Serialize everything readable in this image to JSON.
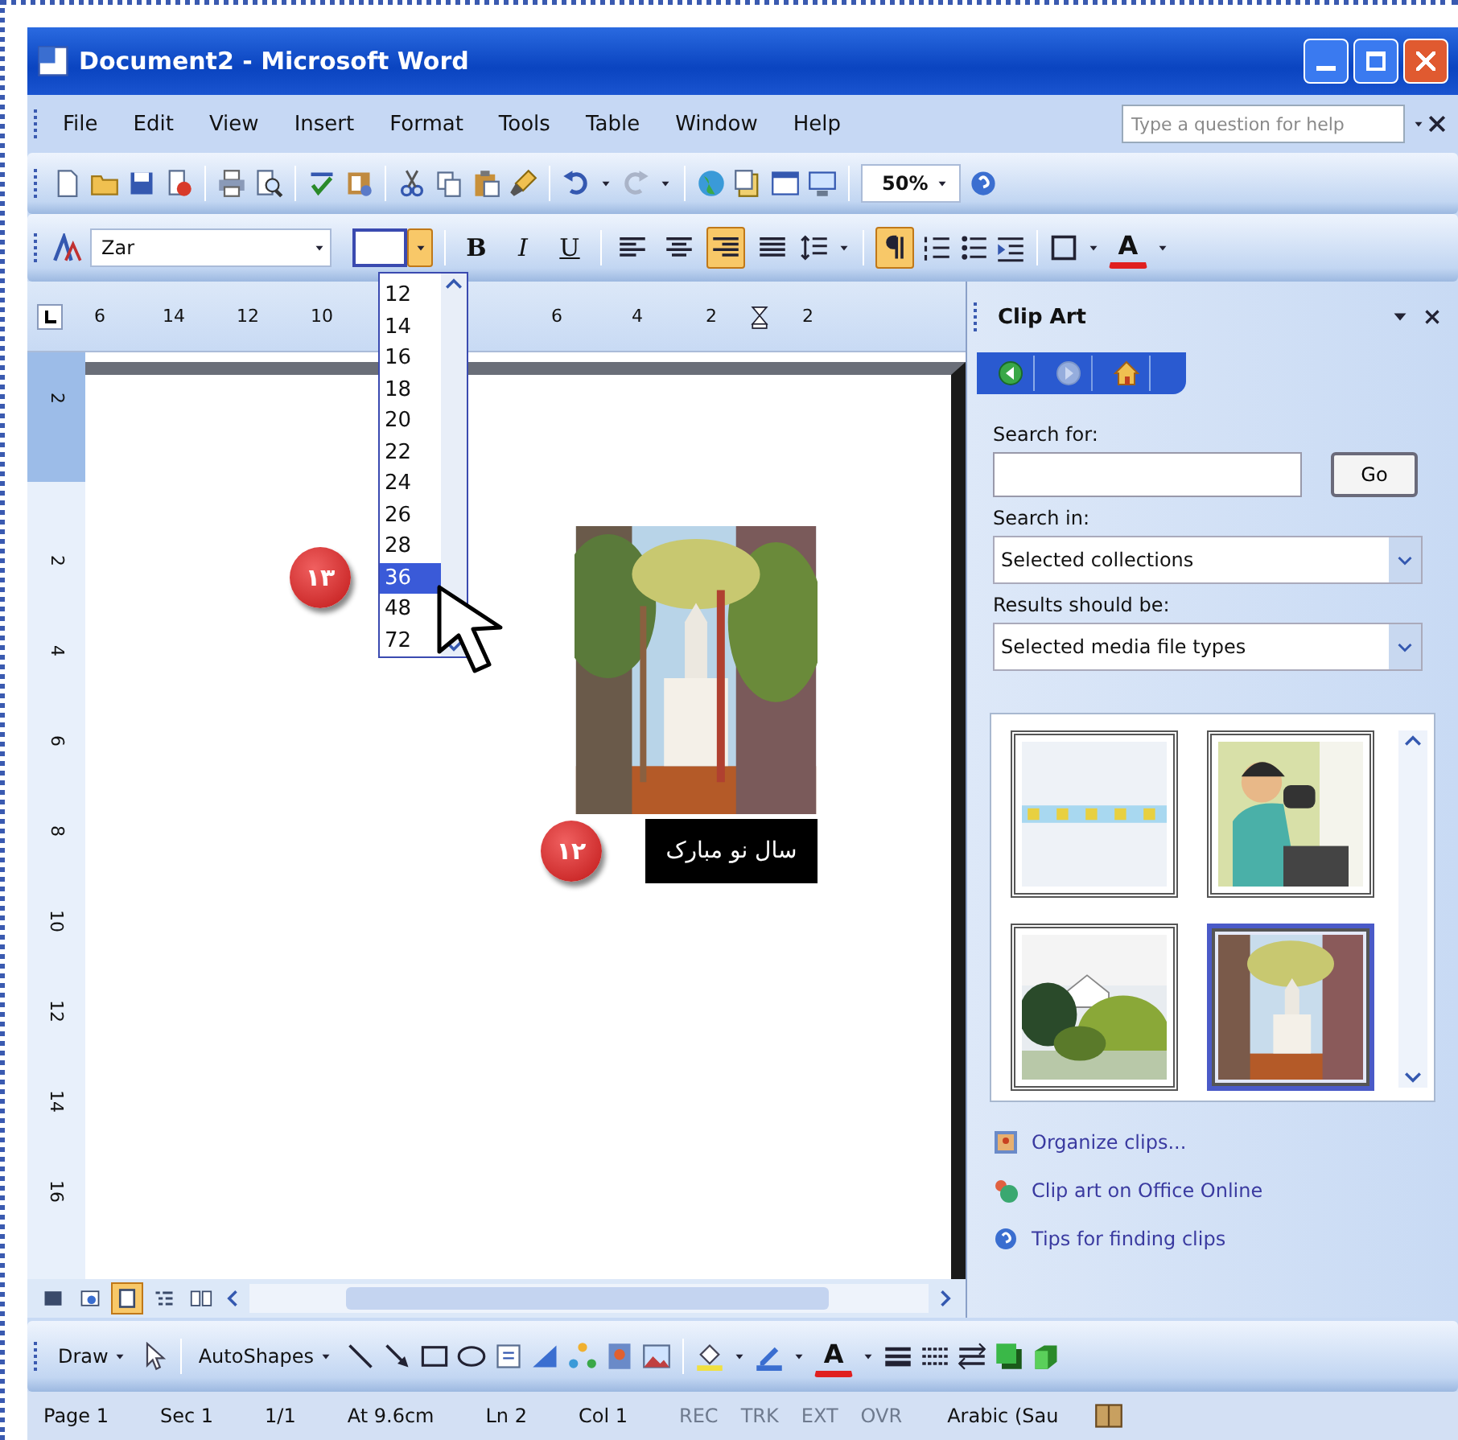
{
  "window": {
    "title": "Document2 - Microsoft Word"
  },
  "menu": [
    "File",
    "Edit",
    "View",
    "Insert",
    "Format",
    "Tools",
    "Table",
    "Window",
    "Help"
  ],
  "help_box": {
    "placeholder": "Type a question for help"
  },
  "standard_toolbar": {
    "zoom": "50%"
  },
  "formatting_toolbar": {
    "font": "Zar",
    "size_list_open": true,
    "bold": "B",
    "italic": "I",
    "underline": "U",
    "rtl_on": true,
    "font_color": "A",
    "align_buttons": [
      {
        "selected": false
      },
      {
        "selected": false
      },
      {
        "selected": true
      },
      {
        "selected": false
      }
    ]
  },
  "font_size_list": [
    {
      "label": "12",
      "selected": false
    },
    {
      "label": "14",
      "selected": false
    },
    {
      "label": "16",
      "selected": false
    },
    {
      "label": "18",
      "selected": false
    },
    {
      "label": "20",
      "selected": false
    },
    {
      "label": "22",
      "selected": false
    },
    {
      "label": "24",
      "selected": false
    },
    {
      "label": "26",
      "selected": false
    },
    {
      "label": "28",
      "selected": false
    },
    {
      "label": "36",
      "selected": true
    },
    {
      "label": "48",
      "selected": false
    },
    {
      "label": "72",
      "selected": false
    }
  ],
  "ruler": {
    "labels": [
      "6",
      "14",
      "12",
      "10",
      "6",
      "4",
      "2",
      "2"
    ]
  },
  "vertical_ruler": {
    "labels": [
      "2",
      "2",
      "4",
      "6",
      "8",
      "10",
      "12",
      "14",
      "16"
    ]
  },
  "document": {
    "text": "سال نو مبارک"
  },
  "callouts": [
    {
      "label": "۱۳"
    },
    {
      "label": "۱۲"
    }
  ],
  "task_pane": {
    "title": "Clip Art",
    "search_label": "Search for:",
    "go": "Go",
    "search_in_label": "Search in:",
    "search_in": "Selected collections",
    "results_label": "Results should be:",
    "results": "Selected media file types",
    "nav": [
      {
        "disabled": false
      },
      {
        "disabled": true
      },
      {
        "disabled": false
      }
    ],
    "clips": [
      {
        "kind": "picture",
        "selected": false
      },
      {
        "kind": "picture",
        "selected": false
      },
      {
        "kind": "picture",
        "selected": false
      },
      {
        "kind": "picture",
        "selected": true
      }
    ],
    "links": [
      "Organize clips...",
      "Clip art on Office Online",
      "Tips for finding clips"
    ]
  },
  "view_buttons": [
    {
      "selected": false
    },
    {
      "selected": false
    },
    {
      "selected": true
    },
    {
      "selected": false
    },
    {
      "selected": false
    }
  ],
  "drawing_toolbar": {
    "draw": "Draw",
    "autoshapes": "AutoShapes",
    "font_color": "A"
  },
  "status_bar": [
    {
      "text": "Page 1",
      "disabled": false
    },
    {
      "text": "Sec 1",
      "disabled": false
    },
    {
      "text": "1/1",
      "disabled": false
    },
    {
      "text": "At 9.6cm",
      "disabled": false
    },
    {
      "text": "Ln 2",
      "disabled": false
    },
    {
      "text": "Col 1",
      "disabled": false
    },
    {
      "text": "REC",
      "disabled": true
    },
    {
      "text": "TRK",
      "disabled": true
    },
    {
      "text": "EXT",
      "disabled": true
    },
    {
      "text": "OVR",
      "disabled": true
    },
    {
      "text": "Arabic (Sau",
      "disabled": false
    }
  ]
}
